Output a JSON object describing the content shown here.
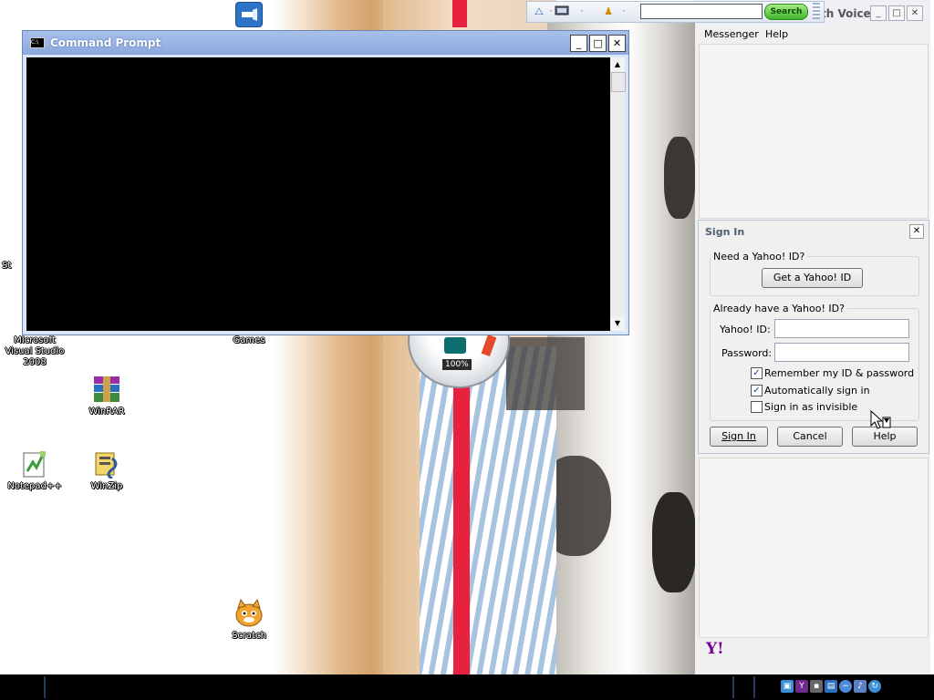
{
  "desktop": {
    "icons": [
      {
        "label": "Microsoft Visual Studio 2008",
        "icon": "visual-studio-icon"
      },
      {
        "label": "Games",
        "icon": "games-icon"
      },
      {
        "label": "WinRAR",
        "icon": "winrar-icon"
      },
      {
        "label": "Notepad++",
        "icon": "notepadpp-icon"
      },
      {
        "label": "WinZip",
        "icon": "winzip-icon"
      },
      {
        "label": "Scratch",
        "icon": "scratch-icon"
      },
      {
        "label": "St",
        "icon": "partial-icon"
      }
    ]
  },
  "gadget": {
    "percent": "100%"
  },
  "cmd": {
    "title": "Command Prompt",
    "buttons": {
      "minimize": "_",
      "maximize": "□",
      "close": "✕"
    }
  },
  "toolbar": {
    "search_value": "",
    "search_label": "Search",
    "dropdown_arrow": "-"
  },
  "messenger": {
    "title_fragment": "th Voice",
    "menu": [
      "Messenger",
      "Help"
    ],
    "logo": "Y!",
    "window_buttons": {
      "minimize": "_",
      "maximize": "□",
      "close": "✕"
    }
  },
  "signin": {
    "title": "Sign In",
    "close": "✕",
    "need_id_legend": "Need a Yahoo! ID?",
    "get_id_button": "Get a Yahoo! ID",
    "already_legend": "Already have a Yahoo! ID?",
    "yahoo_id_label": "Yahoo! ID:",
    "yahoo_id_value": "",
    "password_label": "Password:",
    "password_value": "",
    "remember_label": "Remember my ID & password",
    "remember_checked": true,
    "auto_label": "Automatically sign in",
    "auto_checked": true,
    "invisible_label": "Sign in as invisible",
    "invisible_checked": false,
    "signin_button": "Sign In",
    "cancel_button": "Cancel",
    "help_button": "Help",
    "check_mark": "✓"
  },
  "colors": {
    "cmd_title": "#8ba8de",
    "yahoo_purple": "#7b0099",
    "search_green": "#3fb42a",
    "taskbar": "#000000"
  }
}
